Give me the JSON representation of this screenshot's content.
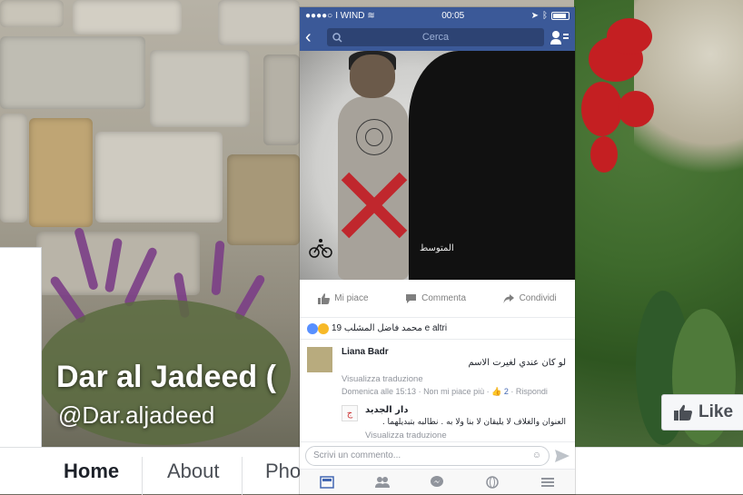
{
  "page": {
    "name": "Dar al Jadeed (",
    "handle": "@Dar.aljadeed",
    "like_label": "Like"
  },
  "nav": {
    "home": "Home",
    "about": "About",
    "photos": "Pho"
  },
  "phone": {
    "status": {
      "carrier": "I WIND",
      "time": "00:05"
    },
    "search_placeholder": "Cerca",
    "photo_watermark": "المتوسط",
    "actions": {
      "like": "Mi piace",
      "comment": "Commenta",
      "share": "Condividi"
    },
    "reactions_text": "محمد فاضل المشلب 19 e altri",
    "comments": [
      {
        "name": "Liana Badr",
        "text": "لو كان عندي لغيرت الاسم",
        "translation": "Visualizza traduzione",
        "meta_time": "Domenica alle 15:13",
        "meta_unlike": "Non mi piace più",
        "meta_likes": "2",
        "meta_reply": "Rispondi"
      },
      {
        "name": "دار الجديد",
        "text": "العنوان والغلاف لا يليقان لا بنا ولا به . نطالبه بتبديلهما .",
        "translation": "Visualizza traduzione"
      }
    ],
    "comment_placeholder": "Scrivi un commento..."
  },
  "colors": {
    "facebook_blue": "#3b5998",
    "cross_red": "#c0272d"
  }
}
